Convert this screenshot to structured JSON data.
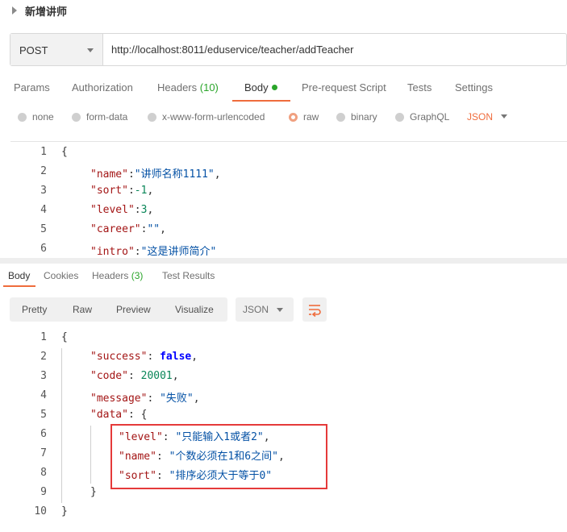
{
  "request": {
    "name": "新增讲师",
    "method": "POST",
    "url": "http://localhost:8011/eduservice/teacher/addTeacher"
  },
  "request_tabs": {
    "params": "Params",
    "authorization": "Authorization",
    "headers": "Headers",
    "headers_count": "(10)",
    "body": "Body",
    "prerequest": "Pre-request Script",
    "tests": "Tests",
    "settings": "Settings",
    "active": "Body"
  },
  "body_types": {
    "none": "none",
    "form_data": "form-data",
    "urlencoded": "x-www-form-urlencoded",
    "raw": "raw",
    "binary": "binary",
    "graphql": "GraphQL",
    "selected": "raw",
    "format": "JSON"
  },
  "request_body": {
    "line_numbers": [
      "1",
      "2",
      "3",
      "4",
      "5",
      "6"
    ],
    "open_brace": "{",
    "name_key": "\"name\"",
    "name_value": "\"讲师名称1111\"",
    "sort_key": "\"sort\"",
    "sort_value": "-1",
    "level_key": "\"level\"",
    "level_value": "3",
    "career_key": "\"career\"",
    "career_value": "\"\"",
    "intro_key": "\"intro\"",
    "intro_value": "\"这是讲师简介\""
  },
  "response_tabs": {
    "body": "Body",
    "cookies": "Cookies",
    "headers": "Headers",
    "headers_count": "(3)",
    "test_results": "Test Results",
    "active": "Body"
  },
  "response_view": {
    "pretty": "Pretty",
    "raw": "Raw",
    "preview": "Preview",
    "visualize": "Visualize",
    "format": "JSON",
    "wrap_icon": "wrap-lines-icon"
  },
  "response_body": {
    "line_numbers": [
      "1",
      "2",
      "3",
      "4",
      "5",
      "6",
      "7",
      "8",
      "9",
      "10"
    ],
    "open_brace": "{",
    "close_brace": "}",
    "success_key": "\"success\"",
    "success_value": "false",
    "code_key": "\"code\"",
    "code_value": "20001",
    "message_key": "\"message\"",
    "message_value": "\"失败\"",
    "data_key": "\"data\"",
    "data_open": "{",
    "level_key": "\"level\"",
    "level_value": "\"只能输入1或者2\"",
    "name_key": "\"name\"",
    "name_value": "\"个数必须在1和6之间\"",
    "sort_key": "\"sort\"",
    "sort_value": "\"排序必须大于等于0\"",
    "data_close": "}"
  },
  "colors": {
    "accent": "#ef6c3c",
    "success_green": "#2aa52a",
    "highlight_red": "#e53a3a"
  }
}
